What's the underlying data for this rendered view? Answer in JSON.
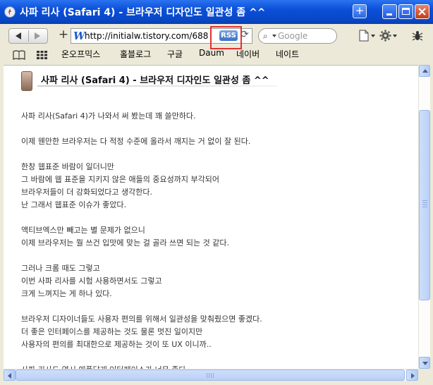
{
  "window": {
    "title": "사파 리사 (Safari 4) - 브라우저 디자인도 일관성 좀 ^^",
    "new_tab_label": "+"
  },
  "navbar": {
    "url": "http://initialw.tistory.com/688",
    "url_site_letter": "W",
    "add_label": "+",
    "rss_label": "RSS",
    "reload_glyph": "⟳",
    "search_placeholder": "Google",
    "search_glyph": "⌕"
  },
  "bookmarks": {
    "items": [
      "온오프믹스",
      "홀블로그",
      "구글",
      "Daum",
      "네이버",
      "네이트"
    ]
  },
  "post": {
    "title": "사파 리사 (Safari 4) - 브라우저 디자인도 일관성 좀 ^^",
    "paragraphs": [
      [
        "사파 리사(Safari 4)가 나와서 써 봤는데 꽤 쓸만하다."
      ],
      [
        "이제 웬만한 브라우저는 다 적정 수준에 올라서 깨지는 거 없이 잘 된다."
      ],
      [
        "한창 웹표준 바람이 일더니만",
        "그 바람에 웹 표준을 지키지 않은 애들의 중요성까지 부각되어",
        "브라우저들이 더 강화되었다고 생각한다.",
        "난 그래서 웹표준 이슈가 좋았다."
      ],
      [
        "액티브엑스만 빼고는 별 문제가 없으니",
        "이제 브라우저는 뭘 쓰건 입맛에 맞는 걸 골라 쓰면 되는 것 같다."
      ],
      [
        "그러나 크롬 때도 그렇고",
        "이번 사파 리사를 시험 사용하면서도 그렇고",
        "크게 느껴지는 게 하나 있다."
      ],
      [
        "브라우저 디자이너들도 사용자 편의를 위해서 일관성을 맞춰줬으면 좋겠다.",
        "더 좋은 인터페이스를 제공하는 것도 물론 멋진 일이지만",
        "사용자의 편의를 최대한으로 제공하는 것이 또 UX 이니까.."
      ],
      [
        "사파 리사도 역시 애플답게 인터페이스가 너무 좋다."
      ]
    ]
  },
  "colors": {
    "titlebar": "#0b4fd8",
    "highlight": "#e0332f",
    "rss_badge": "#3b6fc4"
  }
}
